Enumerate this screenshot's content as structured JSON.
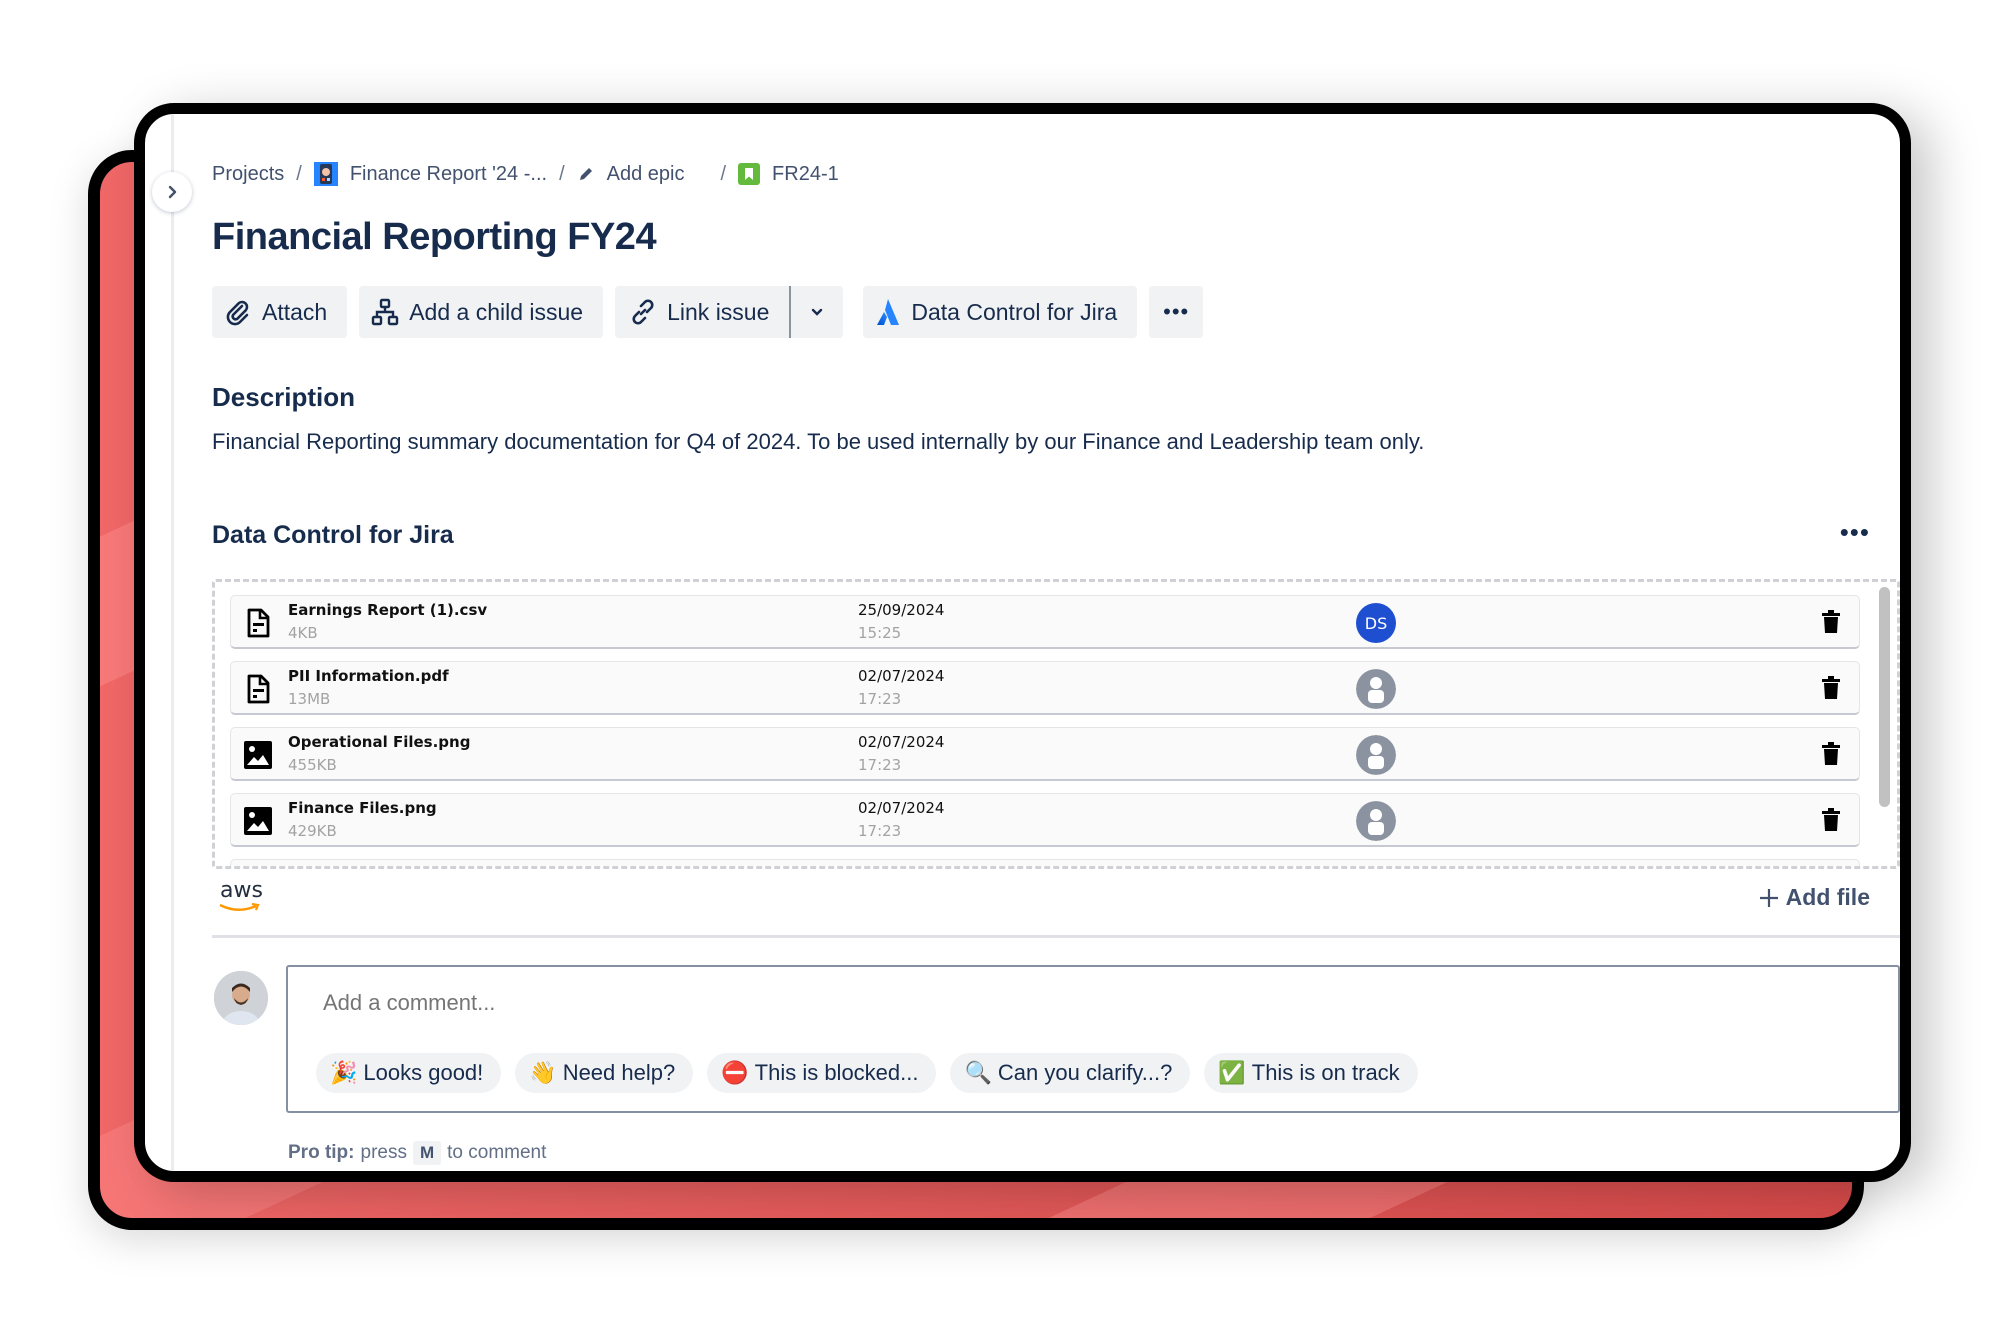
{
  "breadcrumb": {
    "items": [
      {
        "label": "Projects",
        "icon": null
      },
      {
        "label": "Finance Report '24 -...",
        "icon": "project-avatar-icon"
      },
      {
        "label": "Add epic",
        "icon": "pencil-icon"
      },
      {
        "label": "FR24-1",
        "icon": "story-bookmark-icon"
      }
    ],
    "separator": "/"
  },
  "issue": {
    "title": "Financial Reporting FY24"
  },
  "toolbar": {
    "attach": "Attach",
    "add_child": "Add a child issue",
    "link_issue": "Link issue",
    "data_control": "Data Control for Jira",
    "more": "•••"
  },
  "description": {
    "heading": "Description",
    "text": "Financial Reporting summary documentation for Q4 of 2024. To be used internally by our Finance and Leadership team only."
  },
  "data_control": {
    "heading": "Data Control for Jira",
    "more": "•••",
    "storage_label": "aws",
    "add_file": "Add file",
    "files": [
      {
        "name": "Earnings Report (1).csv",
        "size": "4KB",
        "date": "25/09/2024",
        "time": "15:25",
        "type": "document",
        "uploader": "DS"
      },
      {
        "name": "PII Information.pdf",
        "size": "13MB",
        "date": "02/07/2024",
        "time": "17:23",
        "type": "document",
        "uploader": null
      },
      {
        "name": "Operational Files.png",
        "size": "455KB",
        "date": "02/07/2024",
        "time": "17:23",
        "type": "image",
        "uploader": null
      },
      {
        "name": "Finance Files.png",
        "size": "429KB",
        "date": "02/07/2024",
        "time": "17:23",
        "type": "image",
        "uploader": null
      }
    ]
  },
  "comment": {
    "placeholder": "Add a comment...",
    "quick_replies": [
      {
        "emoji": "🎉",
        "label": "Looks good!"
      },
      {
        "emoji": "👋",
        "label": "Need help?"
      },
      {
        "emoji": "⛔",
        "label": "This is blocked..."
      },
      {
        "emoji": "🔍",
        "label": "Can you clarify...?"
      },
      {
        "emoji": "✅",
        "label": "This is on track"
      }
    ],
    "pro_tip_label": "Pro tip:",
    "pro_tip_pre": "press",
    "pro_tip_key": "M",
    "pro_tip_post": "to comment"
  },
  "colors": {
    "text_primary": "#172b4d",
    "avatar_ds": "#1f4fd1",
    "accent_red": "#e85656"
  }
}
